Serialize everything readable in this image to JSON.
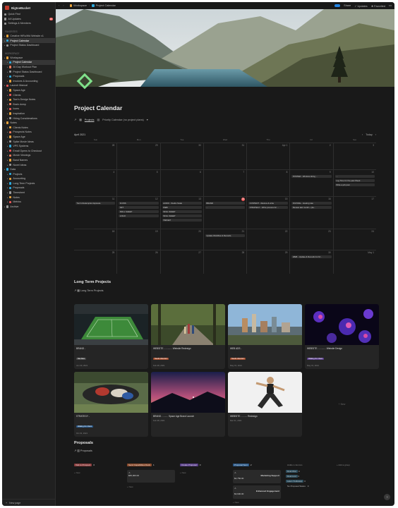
{
  "workspace": {
    "name": "BigtoeBucket"
  },
  "sidebar": {
    "top_items": [
      {
        "label": "Quick Find",
        "color": "#9b9b9b"
      },
      {
        "label": "All Updates",
        "color": "#9b9b9b",
        "badge": "15"
      },
      {
        "label": "Settings & Members",
        "color": "#9b9b9b"
      }
    ],
    "favorites_label": "FAVORITES",
    "favorites": [
      {
        "label": "Creative HiRo/Wd Website v1",
        "color": "#e9a23b"
      },
      {
        "label": "Project Calendar",
        "color": "#2eaadc",
        "active": true
      },
      {
        "label": "Project Status Dashboard",
        "color": "#9b9b9b"
      }
    ],
    "workspace_label": "WORKSPACE",
    "tree": [
      {
        "label": "Workspace",
        "color": "#e9a23b",
        "lvl": 0
      },
      {
        "label": "Project Calendar",
        "color": "#2eaadc",
        "lvl": 1,
        "active": true
      },
      {
        "label": "30 Day Workout Plan",
        "color": "#ef7b5c",
        "lvl": 1
      },
      {
        "label": "Project Status Dashboard",
        "color": "#9b9b9b",
        "lvl": 1
      },
      {
        "label": "Proposals",
        "color": "#2eaadc",
        "lvl": 1
      },
      {
        "label": "Invoices & Accounting",
        "color": "#e9a23b",
        "lvl": 1
      },
      {
        "label": "Launch Manual",
        "color": "#eb5757",
        "lvl": 0
      },
      {
        "label": "Space Age",
        "color": "#e9a23b",
        "lvl": 1
      },
      {
        "label": "Clients",
        "color": "#eb5757",
        "lvl": 1
      },
      {
        "label": "Tom's Design Notes",
        "color": "#e9a23b",
        "lvl": 1
      },
      {
        "label": "Brain dump",
        "color": "#ef7b5c",
        "lvl": 1
      },
      {
        "label": "Icons",
        "color": "#eb5757",
        "lvl": 1
      },
      {
        "label": "Inspiration",
        "color": "#e9a23b",
        "lvl": 1
      },
      {
        "label": "Hiring Considerations",
        "color": "#9b9b9b",
        "lvl": 1
      },
      {
        "label": "Notes",
        "color": "#e9a23b",
        "lvl": 0
      },
      {
        "label": "Clients Notes",
        "color": "#e9a23b",
        "lvl": 1
      },
      {
        "label": "Prospects Notes",
        "color": "#ef7b5c",
        "lvl": 1
      },
      {
        "label": "Space Age",
        "color": "#e9a23b",
        "lvl": 1
      },
      {
        "label": "Spike Movie Ideas",
        "color": "#9b9b9b",
        "lvl": 1
      },
      {
        "label": "VPS Systems",
        "color": "#2eaadc",
        "lvl": 1
      },
      {
        "label": "Email Opens to Checkout",
        "color": "#eb5757",
        "lvl": 1
      },
      {
        "label": "Movie Viewings",
        "color": "#ef7b5c",
        "lvl": 1
      },
      {
        "label": "Band Names",
        "color": "#e9a23b",
        "lvl": 1
      },
      {
        "label": "Novel Ideas",
        "color": "#9b9b9b",
        "lvl": 1
      },
      {
        "label": "Data",
        "color": "#2eaadc",
        "lvl": 0
      },
      {
        "label": "Projects",
        "color": "#2eaadc",
        "lvl": 1
      },
      {
        "label": "Accounting",
        "color": "#e9a23b",
        "lvl": 1
      },
      {
        "label": "Long Term Projects",
        "color": "#2eaadc",
        "lvl": 1
      },
      {
        "label": "Proposals",
        "color": "#2eaadc",
        "lvl": 1
      },
      {
        "label": "Timesheet",
        "color": "#9b9b9b",
        "lvl": 1
      },
      {
        "label": "Notes",
        "color": "#e9a23b",
        "lvl": 1
      },
      {
        "label": "Metrics",
        "color": "#eb5757",
        "lvl": 1
      },
      {
        "label": "Archive",
        "color": "#9b9b9b",
        "lvl": 0
      }
    ],
    "new_page": "New page"
  },
  "topbar": {
    "crumb_workspace": "Workspace",
    "crumb_page": "Project Calendar",
    "share": "Share",
    "updates": "Updates",
    "favorited": "Favorited",
    "more": "•••"
  },
  "page": {
    "title": "Project Calendar",
    "view_link": "Projects",
    "view_name": "Priority Calendar (no project plans)",
    "month": "April 2021",
    "today": "Today",
    "days": [
      "Sun",
      "Mon",
      "Tue",
      "Wed",
      "Thu",
      "Fri",
      "Sat"
    ],
    "weeks": [
      {
        "nums": [
          "28",
          "29",
          "30",
          "31",
          "Apr 1",
          "2",
          "3"
        ],
        "events": [
          [],
          [],
          [],
          [],
          [],
          [],
          []
        ]
      },
      {
        "nums": [
          "4",
          "5",
          "6",
          "7",
          "8",
          "9",
          "10"
        ],
        "events": [
          [],
          [],
          [],
          [],
          [],
          [
            "POSTER - Window Hiring ..."
          ],
          [
            "...",
            "Log Time for the past Week",
            "Write a job post"
          ]
        ]
      },
      {
        "nums": [
          "11",
          "12",
          "13",
          "14",
          "15",
          "16",
          "17"
        ],
        "today_index": 3,
        "events": [
          [
            "Tom's Redemption Episode"
          ],
          [
            "ICONS",
            "NFT",
            "SKILL SHEET",
            "LOGO"
          ],
          [
            "AUDIO - Studio Scale",
            "WEB",
            "SKILL SHEET",
            "SKILL SHEET",
            "TARGET"
          ],
          [
            "BRAND",
            "..."
          ],
          [
            "CONTENT - Review & write",
            "STRATEGY - Write process for ..."
          ],
          [
            "INVOICE - Hosting rate",
            "Review last month + pla..."
          ],
          []
        ]
      },
      {
        "nums": [
          "18",
          "19",
          "20",
          "21",
          "22",
          "23",
          "24"
        ],
        "events": [
          [],
          [],
          [],
          [
            "Update Workflow & Records"
          ],
          [],
          [],
          []
        ]
      },
      {
        "nums": [
          "25",
          "26",
          "27",
          "28",
          "29",
          "30",
          "May 1"
        ],
        "events": [
          [],
          [],
          [],
          [],
          [],
          [
            "WEB - Update & Records for M..."
          ],
          []
        ]
      }
    ]
  },
  "long_term": {
    "heading": "Long Term Projects",
    "view": "Long Term Projects",
    "cards": [
      {
        "title": "BRAND - ",
        "tag": "Not Now",
        "tag_color": "#4a4a4a",
        "date": "Jun 30, 2021",
        "img": "stadium"
      },
      {
        "title": "WEBSITE - ........... Website Redesign",
        "tag": "Needs Attention",
        "tag_color": "#a24b2b",
        "date": "Feb 28, 2021",
        "img": "forest"
      },
      {
        "title": "WEB ADS - ",
        "tag": "Needs Attention",
        "tag_color": "#a24b2b",
        "date": "May 31, 2021",
        "img": "city"
      },
      {
        "title": "WEBSITE - ........... Website Design",
        "tag": "Waiting On Client",
        "tag_color": "#5a3f8a",
        "date": "May 31, 2021",
        "img": "cells"
      },
      {
        "title": "STRATEGY - ",
        "tag": "Waiting On Client",
        "tag_color": "#2b5a8a",
        "date": "Oct 31, 2021",
        "img": "rugby"
      },
      {
        "title": "BRAND - ........ Space Age Brand Launch",
        "tag": "",
        "tag_color": "#4a4a4a",
        "date": "Feb 28, 2021",
        "img": "dusk"
      },
      {
        "title": "WEBSITE - ........ Redesign",
        "tag": "",
        "tag_color": "#4a4a4a",
        "date": "Mar 31, 2021",
        "img": "runner"
      }
    ],
    "new": "+ New"
  },
  "proposals": {
    "heading": "Proposals",
    "view": "Proposals",
    "columns": [
      {
        "label": "Talk to Prospect",
        "count": "0",
        "color": "#8a3b3b"
      },
      {
        "label": "Send Capabilities Deck",
        "count": "1",
        "color": "#8a4a2b"
      },
      {
        "label": "Create Proposal",
        "count": "0",
        "color": "#5a3f8a"
      },
      {
        "label": "Proposal Sent",
        "count": "2",
        "color": "#2b5a8a"
      },
      {
        "label": "Hidden columns",
        "count": "",
        "color": "transparent"
      },
      {
        "label": "+ Add a group",
        "count": "",
        "color": "transparent"
      }
    ],
    "deck_card": {
      "title": "...",
      "value": "$65,000.00"
    },
    "sent_cards": [
      {
        "title": "Marketing Support",
        "value": "$2,750.00"
      },
      {
        "title": "Enhanced Engagement",
        "value": "$3,600.00"
      }
    ],
    "hidden": [
      {
        "label": "Deal Won",
        "count": "0"
      },
      {
        "label": "Deal Lost",
        "count": "0"
      },
      {
        "label": "Later / Followup",
        "count": "0"
      },
      {
        "label": "No Proposal Status",
        "count": "0"
      }
    ],
    "new": "+ New"
  }
}
